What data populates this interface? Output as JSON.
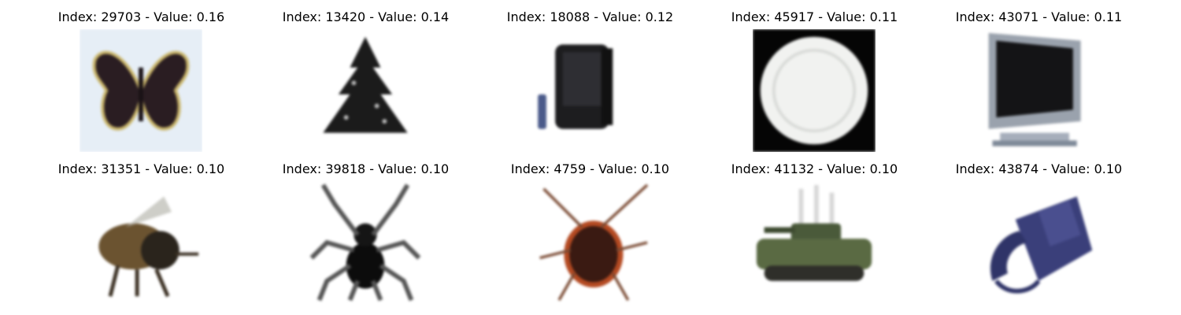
{
  "grid": [
    {
      "caption": "Index: 29703 - Value: 0.16",
      "subject": "butterfly"
    },
    {
      "caption": "Index: 13420 - Value: 0.14",
      "subject": "pine tree"
    },
    {
      "caption": "Index: 18088 - Value: 0.12",
      "subject": "television with remote"
    },
    {
      "caption": "Index: 45917 - Value: 0.11",
      "subject": "plate"
    },
    {
      "caption": "Index: 43071 - Value: 0.11",
      "subject": "flat-screen television"
    },
    {
      "caption": "Index: 31351 - Value: 0.10",
      "subject": "bee"
    },
    {
      "caption": "Index: 39818 - Value: 0.10",
      "subject": "spider"
    },
    {
      "caption": "Index: 4759 - Value: 0.10",
      "subject": "cockroach"
    },
    {
      "caption": "Index: 41132 - Value: 0.10",
      "subject": "tank"
    },
    {
      "caption": "Index: 43874 - Value: 0.10",
      "subject": "telephone"
    }
  ]
}
